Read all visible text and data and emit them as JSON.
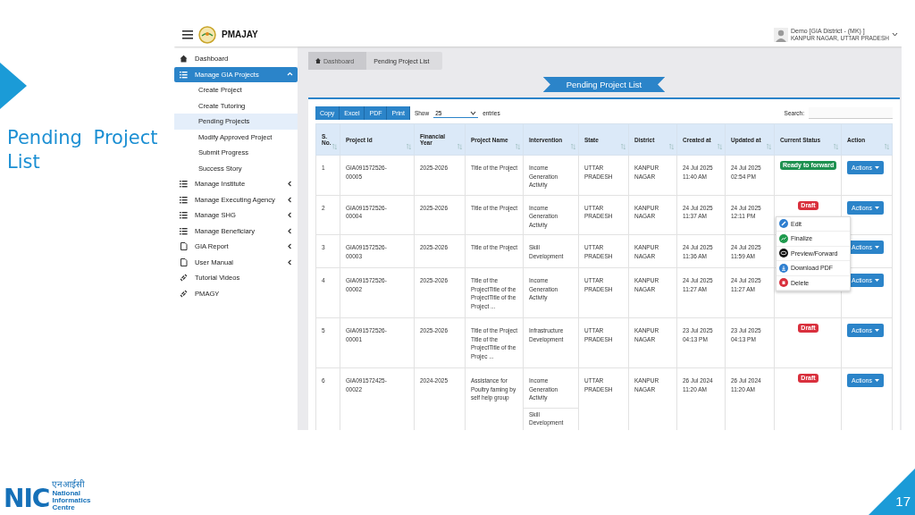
{
  "slide": {
    "title": "Pending Project List",
    "page_number": "17",
    "footer_logo": {
      "mark": "NIC",
      "hindi": "एनआईसी",
      "lines": [
        "National",
        "Informatics",
        "Centre"
      ]
    }
  },
  "app": {
    "name": "PMAJAY",
    "user": {
      "name": "Demo [GIA District - (MK) ]",
      "location": "KANPUR NAGAR, UTTAR PRADESH"
    }
  },
  "sidebar": {
    "items": [
      {
        "label": "Dashboard",
        "selected": false
      },
      {
        "label": "Manage GIA Projects",
        "selected": true,
        "expanded": true,
        "children": [
          {
            "label": "Create Project",
            "selected": false
          },
          {
            "label": "Create Tutoring",
            "selected": false
          },
          {
            "label": "Pending Projects",
            "selected": true
          },
          {
            "label": "Modify Approved Project",
            "selected": false
          },
          {
            "label": "Submit Progress",
            "selected": false
          },
          {
            "label": "Success Story",
            "selected": false
          }
        ]
      },
      {
        "label": "Manage Institute",
        "selected": false,
        "expanded": false
      },
      {
        "label": "Manage Executing Agency",
        "selected": false,
        "expanded": false
      },
      {
        "label": "Manage SHG",
        "selected": false,
        "expanded": false
      },
      {
        "label": "Manage Beneficiary",
        "selected": false,
        "expanded": false
      },
      {
        "label": "GIA Report",
        "selected": false,
        "expanded": false
      },
      {
        "label": "User Manual",
        "selected": false,
        "expanded": false
      },
      {
        "label": "Tutorial Videos",
        "selected": false
      },
      {
        "label": "PMAGY",
        "selected": false
      }
    ]
  },
  "breadcrumb": [
    {
      "label": "Dashboard"
    },
    {
      "label": "Pending Project List"
    }
  ],
  "page_title": "Pending Project List",
  "toolbar": {
    "buttons": [
      "Copy",
      "Excel",
      "PDF",
      "Print"
    ],
    "show_label": "Show",
    "page_size": "25",
    "entries_label": "entries",
    "search_label": "Search:"
  },
  "table": {
    "columns": [
      "S. No.",
      "Project Id",
      "Financial Year",
      "Project Name",
      "Intervention",
      "State",
      "District",
      "Created at",
      "Updated at",
      "Current Status",
      "Action"
    ],
    "rows": [
      {
        "sno": "1",
        "project_id": "GIA091572526-00005",
        "year": "2025-2026",
        "name": "Title of the Project",
        "intervention": [
          "Income Generation Activity"
        ],
        "state": "UTTAR PRADESH",
        "district": "KANPUR NAGAR",
        "created": "24 Jul 2025 11:40 AM",
        "updated": "24 Jul 2025 02:54 PM",
        "status": {
          "label": "Ready to forward",
          "kind": "ready"
        },
        "action": "Actions",
        "menu_open": false
      },
      {
        "sno": "2",
        "project_id": "GIA091572526-00004",
        "year": "2025-2026",
        "name": "Title of the Project",
        "intervention": [
          "Income Generation Activity"
        ],
        "state": "UTTAR PRADESH",
        "district": "KANPUR NAGAR",
        "created": "24 Jul 2025 11:37 AM",
        "updated": "24 Jul 2025 12:11 PM",
        "status": {
          "label": "Draft",
          "kind": "draft"
        },
        "action": "Actions",
        "menu_open": true
      },
      {
        "sno": "3",
        "project_id": "GIA091572526-00003",
        "year": "2025-2026",
        "name": "Title of the Project",
        "intervention": [
          "Skill Development"
        ],
        "state": "UTTAR PRADESH",
        "district": "KANPUR NAGAR",
        "created": "24 Jul 2025 11:36 AM",
        "updated": "24 Jul 2025 11:59 AM",
        "action": "Actions",
        "menu_open": false
      },
      {
        "sno": "4",
        "project_id": "GIA091572526-00002",
        "year": "2025-2026",
        "name": "Title of the ProjectTitle of the ProjectTitle of the Project ...",
        "intervention": [
          "Income Generation Activity"
        ],
        "state": "UTTAR PRADESH",
        "district": "KANPUR NAGAR",
        "created": "24 Jul 2025 11:27 AM",
        "updated": "24 Jul 2025 11:27 AM",
        "action": "Actions",
        "menu_open": false
      },
      {
        "sno": "5",
        "project_id": "GIA091572526-00001",
        "year": "2025-2026",
        "name": "Title of the Project Title of the ProjectTitle of the Projec ...",
        "intervention": [
          "Infrastructure Development"
        ],
        "state": "UTTAR PRADESH",
        "district": "KANPUR NAGAR",
        "created": "23 Jul 2025 04:13 PM",
        "updated": "23 Jul 2025 04:13 PM",
        "status": {
          "label": "Draft",
          "kind": "draft"
        },
        "action": "Actions",
        "menu_open": false
      },
      {
        "sno": "6",
        "project_id": "GIA091572425-00022",
        "year": "2024-2025",
        "name": "Assistance for Poultry faming by self help group",
        "intervention": [
          "Income Generation Activity",
          "Skill Development"
        ],
        "state": "UTTAR PRADESH",
        "district": "KANPUR NAGAR",
        "created": "26 Jul 2024 11:20 AM",
        "updated": "26 Jul 2024 11:20 AM",
        "status": {
          "label": "Draft",
          "kind": "draft"
        },
        "action": "Actions",
        "menu_open": false
      }
    ]
  },
  "actions_menu": [
    {
      "label": "Edit",
      "kind": "edit"
    },
    {
      "label": "Finalize",
      "kind": "finalize"
    },
    {
      "label": "Preview/Forward",
      "kind": "preview"
    },
    {
      "label": "Download PDF",
      "kind": "download"
    },
    {
      "label": "Delete",
      "kind": "delete"
    }
  ]
}
